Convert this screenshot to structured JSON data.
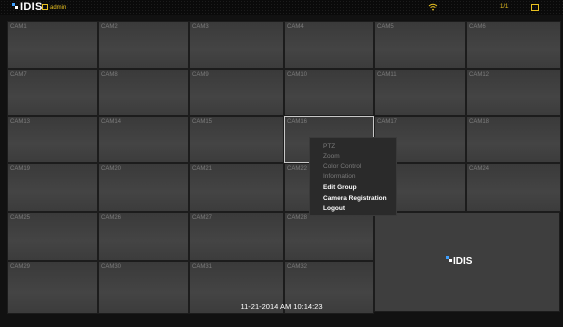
{
  "topbar": {
    "logo_text": "IDIS",
    "user": "admin",
    "page_indicator": "1/1",
    "brand_blue": "#3fa0ff",
    "accent": "#e8c020"
  },
  "cameras": [
    "CAM1",
    "CAM2",
    "CAM3",
    "CAM4",
    "CAM5",
    "CAM6",
    "CAM7",
    "CAM8",
    "CAM9",
    "CAM10",
    "CAM11",
    "CAM12",
    "CAM13",
    "CAM14",
    "CAM15",
    "CAM16",
    "CAM17",
    "CAM18",
    "CAM19",
    "CAM20",
    "CAM21",
    "CAM22",
    "CAM23",
    "CAM24",
    "CAM25",
    "CAM26",
    "CAM27",
    "CAM28",
    "CAM29",
    "CAM30",
    "CAM31",
    "CAM32"
  ],
  "selected_camera": "CAM16",
  "logo_pane_text": "IDIS",
  "datetime": "11-21-2014  AM 10:14:23",
  "context_menu": {
    "items": [
      {
        "label": "PTZ",
        "enabled": false
      },
      {
        "label": "Zoom",
        "enabled": false
      },
      {
        "label": "Color Control",
        "enabled": false
      },
      {
        "label": "Information",
        "enabled": false
      },
      {
        "label": "Edit Group",
        "enabled": true
      },
      {
        "label": "Camera Registration",
        "enabled": true
      },
      {
        "label": "Logout",
        "enabled": true
      }
    ]
  }
}
